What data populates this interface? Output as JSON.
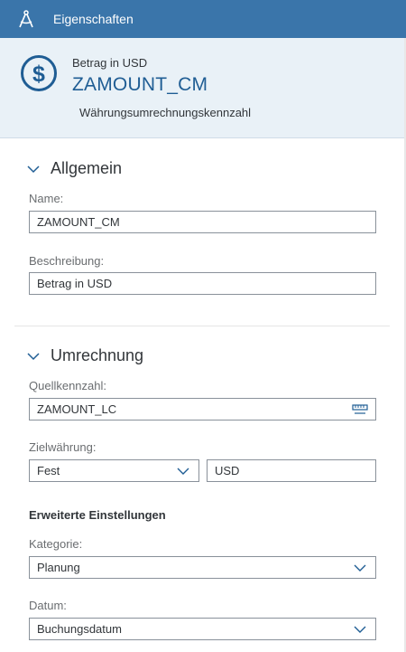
{
  "titlebar": {
    "title": "Eigenschaften",
    "icon": "compass-icon"
  },
  "header": {
    "icon": "dollar-circle-icon",
    "subtitle": "Betrag in USD",
    "title": "ZAMOUNT_CM",
    "description": "Währungsumrechnungskennzahl"
  },
  "general": {
    "heading": "Allgemein",
    "name_label": "Name:",
    "name_value": "ZAMOUNT_CM",
    "desc_label": "Beschreibung:",
    "desc_value": "Betrag in USD"
  },
  "conversion": {
    "heading": "Umrechnung",
    "source_label": "Quellkennzahl:",
    "source_value": "ZAMOUNT_LC",
    "target_label": "Zielwährung:",
    "target_mode": "Fest",
    "target_currency": "USD",
    "advanced_heading": "Erweiterte Einstellungen",
    "category_label": "Kategorie:",
    "category_value": "Planung",
    "date_label": "Datum:",
    "date_value": "Buchungsdatum"
  },
  "colors": {
    "titlebar_bg": "#3a75aa",
    "header_bg": "#e9f1f7",
    "accent": "#1f5d94"
  }
}
